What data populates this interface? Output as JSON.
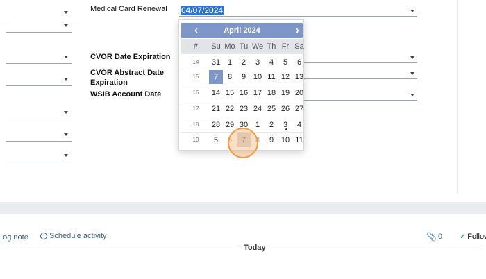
{
  "form": {
    "medical_label": "Medical Card Renewal",
    "medical_value": "04/07/2024",
    "cvor_date_label": "CVOR Date Expiration",
    "cvor_abstract_label": "CVOR Abstract Date Expiration",
    "wsib_label": "WSIB Account Date"
  },
  "datepicker": {
    "month_title": "April 2024",
    "prev_icon": "‹",
    "next_icon": "›",
    "week_header": "#",
    "days": [
      "Su",
      "Mo",
      "Tu",
      "We",
      "Th",
      "Fr",
      "Sa"
    ],
    "weeks": [
      {
        "wk": "14",
        "d": [
          "31",
          "1",
          "2",
          "3",
          "4",
          "5",
          "6"
        ]
      },
      {
        "wk": "15",
        "d": [
          "7",
          "8",
          "9",
          "10",
          "11",
          "12",
          "13"
        ]
      },
      {
        "wk": "16",
        "d": [
          "14",
          "15",
          "16",
          "17",
          "18",
          "19",
          "20"
        ]
      },
      {
        "wk": "17",
        "d": [
          "21",
          "22",
          "23",
          "24",
          "25",
          "26",
          "27"
        ]
      },
      {
        "wk": "18",
        "d": [
          "28",
          "29",
          "30",
          "1",
          "2",
          "3",
          "4"
        ]
      },
      {
        "wk": "19",
        "d": [
          "5",
          "6",
          "7",
          "8",
          "9",
          "10",
          "11"
        ]
      }
    ]
  },
  "chatter": {
    "log_note": "Log note",
    "schedule": "Schedule activity",
    "attachments": "0",
    "follow": "Follow",
    "today": "Today"
  },
  "colors": {
    "header": "#7f96c9",
    "selection": "#2e73d1",
    "touch": "#f39c3d"
  }
}
